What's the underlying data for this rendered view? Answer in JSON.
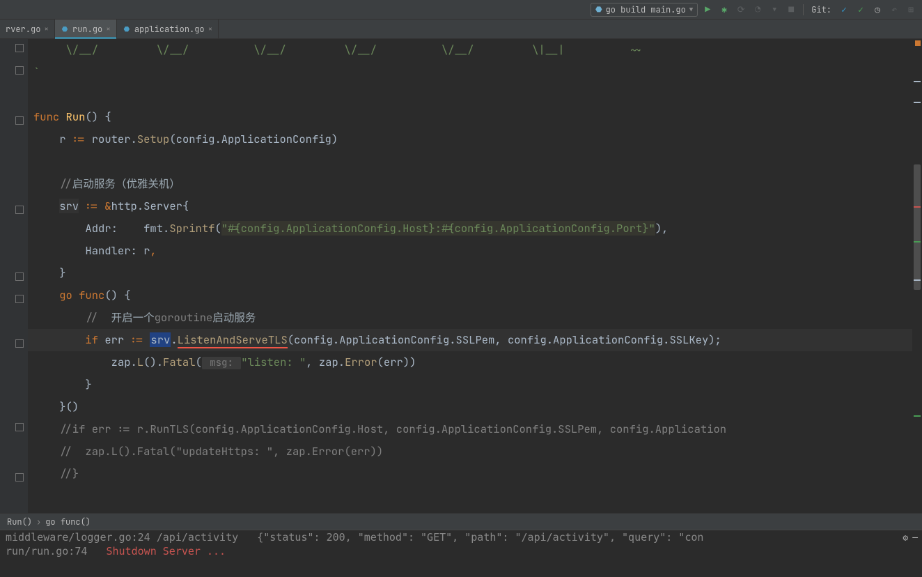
{
  "toolbar": {
    "run_config_label": "go build main.go",
    "git_label": "Git:"
  },
  "tabs": [
    {
      "label": "rver.go",
      "active": false
    },
    {
      "label": "run.go",
      "active": true
    },
    {
      "label": "application.go",
      "active": false
    }
  ],
  "breadcrumb": {
    "items": [
      "Run()",
      "go func()"
    ]
  },
  "code": {
    "line_ascii": "     \\/__/         \\/__/          \\/__/         \\/__/          \\/__/         \\|__|          ~~",
    "line_backtick": "`",
    "line_func": "func Run() {",
    "line_router": "    r := router.Setup(config.ApplicationConfig)",
    "line_cmt_start": "    //启动服务（优雅关机）",
    "line_srv": "    srv := &http.Server{",
    "line_addr_pre": "        Addr:    fmt.Sprintf(",
    "line_addr_str": "\"#{config.ApplicationConfig.Host}:#{config.ApplicationConfig.Port}\"",
    "line_addr_post": "),",
    "line_handler": "        Handler: r,",
    "line_close1": "    }",
    "line_gofunc": "    go func() {",
    "line_cmt_goroutine": "        //  开启一个goroutine启动服务",
    "line_if_pre": "        if err := ",
    "line_srv_tok": "srv",
    "line_dot": ".",
    "line_listen": "ListenAndServeTLS",
    "line_if_post": "(config.ApplicationConfig.SSLPem, config.ApplicationConfig.SSLKey);",
    "line_zap_pre": "            zap.L().Fatal(",
    "line_zap_hint": " msg: ",
    "line_zap_str": "\"listen: \"",
    "line_zap_post": ", zap.Error(err))",
    "line_close2": "        }",
    "line_iife": "    }()",
    "line_cmt2": "    //if err := r.RunTLS(config.ApplicationConfig.Host, config.ApplicationConfig.SSLPem, config.Application",
    "line_cmt3": "    //  zap.L().Fatal(\"updateHttps: \", zap.Error(err))",
    "line_cmt4": "    //}"
  },
  "console": {
    "line1": "middleware/logger.go:24 /api/activity   {\"status\": 200, \"method\": \"GET\", \"path\": \"/api/activity\", \"query\": \"con",
    "line2_pre": "run/run.go:74   ",
    "line2_red": "Shutdown Server ..."
  }
}
